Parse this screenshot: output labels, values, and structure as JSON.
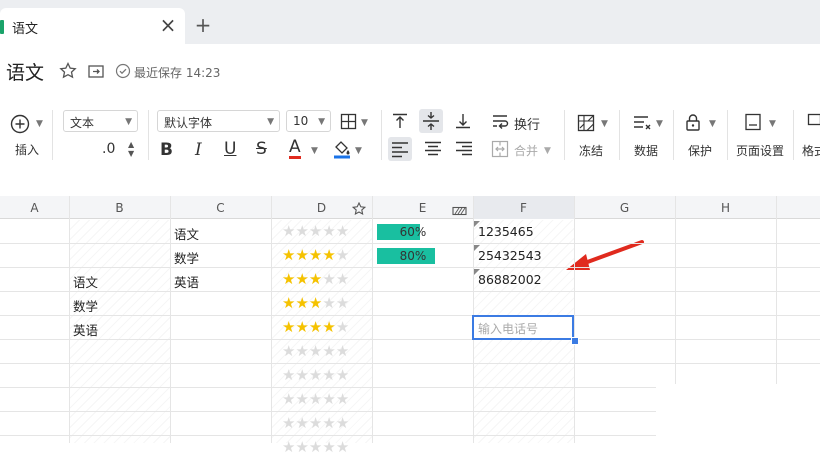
{
  "tab": {
    "title": "语文",
    "close": "×",
    "add": "+"
  },
  "header": {
    "title": "语文",
    "save_status": "最近保存 14:23"
  },
  "toolbar": {
    "insert_label": "插入",
    "format_value": "文本",
    "font_value": "默认字体",
    "size_value": "10",
    "decimal_label": ".0",
    "bold": "B",
    "italic": "I",
    "underline": "U",
    "strike": "S",
    "fontcolor": "A",
    "wrap_label": "换行",
    "merge_label": "合并",
    "freeze_label": "冻结",
    "data_label": "数据",
    "protect_label": "保护",
    "page_setup_label": "页面设置",
    "format_label": "格式"
  },
  "grid": {
    "columns": [
      "A",
      "B",
      "C",
      "D",
      "E",
      "F",
      "G",
      "H"
    ],
    "rows": [
      {
        "B": "",
        "C": "语文",
        "rating": 0,
        "progress": 0.6,
        "progress_label": "60%",
        "phone": "1235465"
      },
      {
        "B": "",
        "C": "数学",
        "rating": 4,
        "progress": 0.8,
        "progress_label": "80%",
        "phone": "25432543"
      },
      {
        "B": "语文",
        "C": "英语",
        "rating": 3,
        "progress": null,
        "progress_label": "",
        "phone": "86882002"
      },
      {
        "B": "数学",
        "C": "",
        "rating": 3,
        "progress": null,
        "progress_label": "",
        "phone": ""
      },
      {
        "B": "英语",
        "C": "",
        "rating": 4,
        "progress": null,
        "progress_label": "",
        "phone": ""
      }
    ],
    "empty_star_rows": 5,
    "phone_placeholder": "输入电话号"
  },
  "colors": {
    "star": "#f5c200",
    "progress": "#19bfa0",
    "selection": "#3b7be3",
    "arrow": "#e02a1e"
  }
}
